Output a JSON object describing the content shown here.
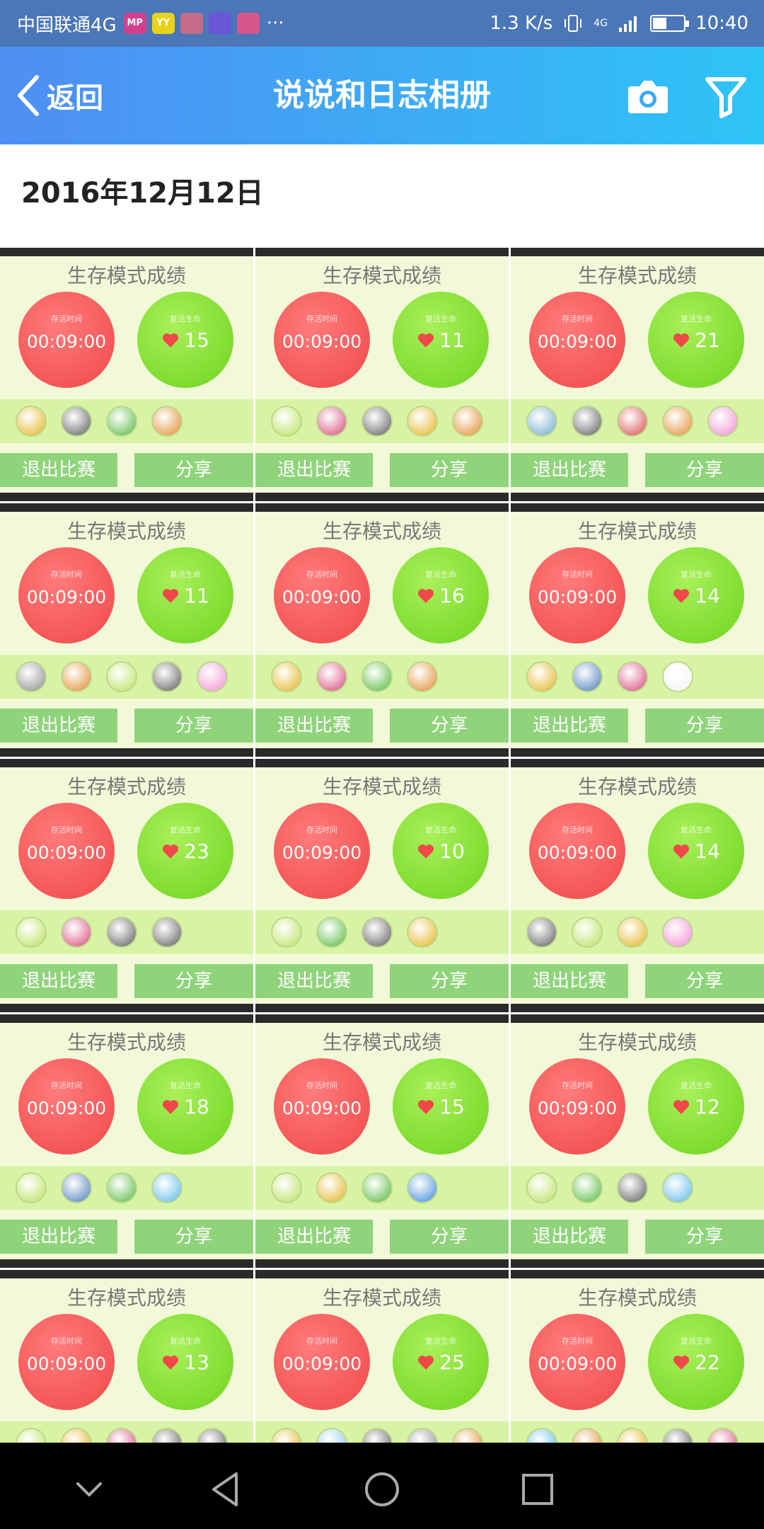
{
  "status_bar": {
    "carrier": "中国联通4G",
    "apps": [
      {
        "name": "mp-app-icon",
        "text": "MP",
        "color": "#d43f8d"
      },
      {
        "name": "yy-app-icon",
        "text": "YY",
        "color": "#e8d21c"
      },
      {
        "name": "app-icon-3",
        "text": "",
        "color": "#c46c8a"
      },
      {
        "name": "video-app-icon",
        "text": "",
        "color": "#6a55d6"
      },
      {
        "name": "app-icon-5",
        "text": "",
        "color": "#d8568c"
      }
    ],
    "overflow": "···",
    "speed": "1.3 K/s",
    "network_type": "4G",
    "battery_level": 0.45,
    "time": "10:40"
  },
  "header": {
    "back_label": "返回",
    "title": "说说和日志相册",
    "camera_icon": "camera-icon",
    "filter_icon": "filter-icon"
  },
  "date_group": "2016年12月12日",
  "photo_card": {
    "title": "生存模式成绩",
    "timer_caption": "存活时间",
    "heart_caption": "复活生命",
    "timer": "00:09:00",
    "exit_label": "退出比赛",
    "share_label": "分享"
  },
  "photos": [
    {
      "hearts": "15",
      "items": [
        "#e3b21c",
        "#5a5a5a",
        "#52b83a",
        "#e08a2a"
      ]
    },
    {
      "hearts": "11",
      "items": [
        "#b8e05a",
        "#d8467a",
        "#5a5a5a",
        "#e3b21c",
        "#e08a2a"
      ]
    },
    {
      "hearts": "21",
      "items": [
        "#6aa8c8",
        "#5a5a5a",
        "#d84a4a",
        "#e08a2a",
        "#f28ad0"
      ]
    },
    {
      "hearts": "11",
      "items": [
        "#8a8a8a",
        "#e08a2a",
        "#b8e05a",
        "#5a5a5a",
        "#f28ad0"
      ]
    },
    {
      "hearts": "16",
      "items": [
        "#e3b21c",
        "#d8467a",
        "#52b83a",
        "#e08a2a"
      ]
    },
    {
      "hearts": "14",
      "items": [
        "#e3b21c",
        "#4a7ab8",
        "#d8467a",
        "#f4f4f4"
      ]
    },
    {
      "hearts": "23",
      "items": [
        "#b8e05a",
        "#d8467a",
        "#5a5a5a",
        "#5a5a5a"
      ]
    },
    {
      "hearts": "10",
      "items": [
        "#b8e05a",
        "#52b83a",
        "#5a5a5a",
        "#e3b21c"
      ]
    },
    {
      "hearts": "14",
      "items": [
        "#5a5a5a",
        "#b8e05a",
        "#e3b21c",
        "#f28ad0"
      ]
    },
    {
      "hearts": "18",
      "items": [
        "#b8e05a",
        "#4a7ab8",
        "#52b83a",
        "#5ab8e8"
      ]
    },
    {
      "hearts": "15",
      "items": [
        "#b8e05a",
        "#e3b21c",
        "#52b83a",
        "#3a8ad8"
      ]
    },
    {
      "hearts": "12",
      "items": [
        "#b8e05a",
        "#52b83a",
        "#5a5a5a",
        "#5ab8e8"
      ]
    },
    {
      "hearts": "13",
      "items": [
        "#b8e05a",
        "#e3b21c",
        "#d8467a",
        "#5a5a5a",
        "#5a5a5a"
      ]
    },
    {
      "hearts": "25",
      "items": [
        "#e3b21c",
        "#8ac8e8",
        "#5a5a5a",
        "#8a8a8a",
        "#e08a2a"
      ]
    },
    {
      "hearts": "22",
      "items": [
        "#5ab8e8",
        "#e08a2a",
        "#e3b21c",
        "#5a5a5a",
        "#d8467a"
      ]
    }
  ],
  "nav": {
    "back_icon": "triangle-back-icon",
    "home_icon": "circle-home-icon",
    "recent_icon": "square-recent-icon",
    "hide_icon": "chevron-down-icon"
  }
}
